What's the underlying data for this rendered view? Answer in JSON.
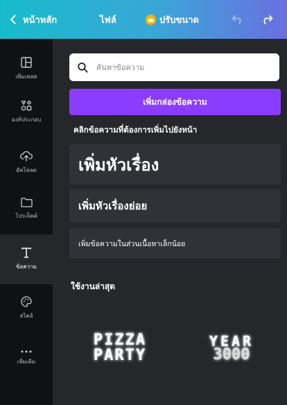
{
  "topbar": {
    "home_label": "หน้าหลัก",
    "file_label": "ไฟล์",
    "resize_label": "ปรับขนาด"
  },
  "rail": {
    "items": [
      {
        "label": "เพิ่มเพลด",
        "icon": "layout-icon"
      },
      {
        "label": "องค์ประกอบ",
        "icon": "elements-icon"
      },
      {
        "label": "อัพโหลด",
        "icon": "upload-icon"
      },
      {
        "label": "โปรเจ็คต์",
        "icon": "folder-icon"
      },
      {
        "label": "ข้อความ",
        "icon": "text-icon"
      },
      {
        "label": "สไตล์",
        "icon": "palette-icon"
      },
      {
        "label": "เพิ่มเติม",
        "icon": "more-icon"
      }
    ],
    "active_index": 4
  },
  "panel": {
    "search_placeholder": "ค้นหาข้อความ",
    "add_textbox_label": "เพิ่มกล่องข้อความ",
    "hint": "คลิกข้อความที่ต้องการเพิ่มไปยังหน้า",
    "heading_label": "เพิ่มหัวเรื่อง",
    "subheading_label": "เพิ่มหัวเรื่องย่อย",
    "body_label": "เพิ่มข้อความในส่วนเนื้อหาเล็กน้อย",
    "recent_title": "ใช้งานล่าสุด",
    "recent": {
      "pizza_line1": "PIZZA",
      "pizza_line2": "PARTY",
      "year_line1": "YEAR",
      "year_line2": "3000"
    }
  },
  "colors": {
    "topbar_start": "#17bccc",
    "topbar_end": "#6a6fe0",
    "accent_purple": "#8b3dff",
    "rail_bg": "#101113",
    "panel_bg": "#25272b",
    "card_bg": "#303237"
  }
}
